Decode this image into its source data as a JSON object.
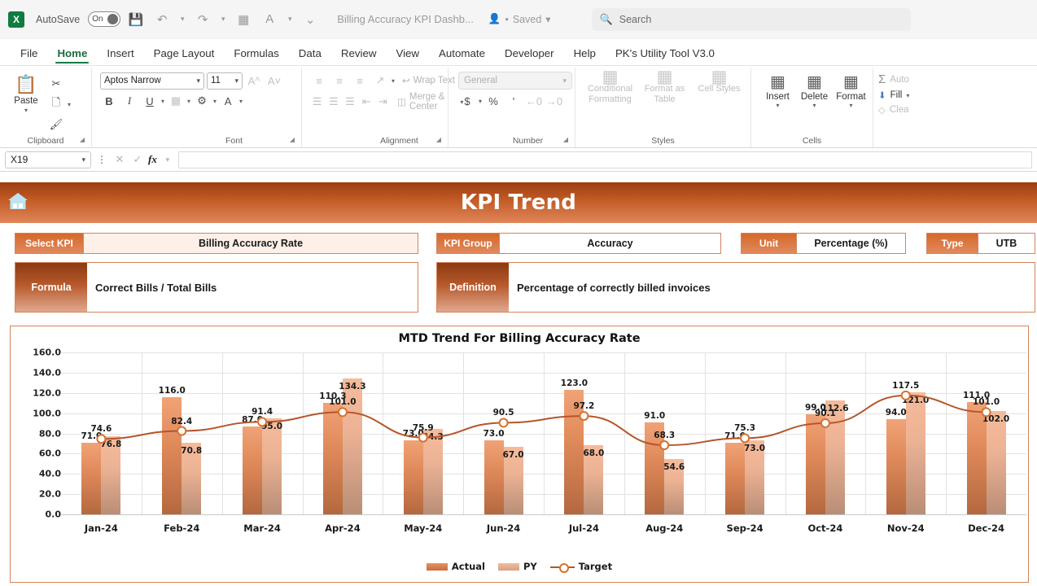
{
  "titlebar": {
    "autosave_label": "AutoSave",
    "autosave_state": "On",
    "document_title": "Billing Accuracy KPI Dashb...",
    "save_status": "Saved",
    "search_placeholder": "Search"
  },
  "menu": {
    "tabs": [
      {
        "label": "File",
        "active": false
      },
      {
        "label": "Home",
        "active": true
      },
      {
        "label": "Insert",
        "active": false
      },
      {
        "label": "Page Layout",
        "active": false
      },
      {
        "label": "Formulas",
        "active": false
      },
      {
        "label": "Data",
        "active": false
      },
      {
        "label": "Review",
        "active": false
      },
      {
        "label": "View",
        "active": false
      },
      {
        "label": "Automate",
        "active": false
      },
      {
        "label": "Developer",
        "active": false
      },
      {
        "label": "Help",
        "active": false
      },
      {
        "label": "PK's Utility Tool V3.0",
        "active": false
      }
    ]
  },
  "ribbon": {
    "clipboard": {
      "group_label": "Clipboard",
      "paste_label": "Paste"
    },
    "font": {
      "group_label": "Font",
      "font_name": "Aptos Narrow",
      "font_size": "11"
    },
    "alignment": {
      "group_label": "Alignment",
      "wrap_text": "Wrap Text",
      "merge_center": "Merge & Center"
    },
    "number": {
      "group_label": "Number",
      "format_value": "General"
    },
    "styles": {
      "group_label": "Styles",
      "conditional_formatting": "Conditional Formatting",
      "format_as_table": "Format as Table",
      "cell_styles": "Cell Styles"
    },
    "cells": {
      "group_label": "Cells",
      "insert": "Insert",
      "delete": "Delete",
      "format": "Format"
    },
    "editing": {
      "autosum": "Auto",
      "fill": "Fill",
      "clear": "Clea"
    }
  },
  "formula_bar": {
    "name_box": "X19",
    "formula_value": ""
  },
  "dashboard": {
    "banner_title": "KPI Trend",
    "chips": [
      {
        "label": "Select KPI",
        "value": "Billing Accuracy Rate"
      },
      {
        "label": "KPI Group",
        "value": "Accuracy"
      },
      {
        "label": "Unit",
        "value": "Percentage (%)"
      },
      {
        "label": "Type",
        "value": "UTB"
      }
    ],
    "info": [
      {
        "label": "Formula",
        "value": "Correct Bills / Total Bills"
      },
      {
        "label": "Definition",
        "value": "Percentage of correctly billed invoices"
      }
    ]
  },
  "chart_data": {
    "type": "bar",
    "title": "MTD Trend For Billing Accuracy Rate",
    "xlabel": "",
    "ylabel": "",
    "ylim": [
      0,
      160
    ],
    "yticks": [
      0,
      20,
      40,
      60,
      80,
      100,
      120,
      140,
      160
    ],
    "ytick_labels": [
      "0.0",
      "20.0",
      "40.0",
      "60.0",
      "80.0",
      "100.0",
      "120.0",
      "140.0",
      "160.0"
    ],
    "grid": true,
    "legend_position": "bottom",
    "categories": [
      "Jan-24",
      "Feb-24",
      "Mar-24",
      "Apr-24",
      "May-24",
      "Jun-24",
      "Jul-24",
      "Aug-24",
      "Sep-24",
      "Oct-24",
      "Nov-24",
      "Dec-24"
    ],
    "series": [
      {
        "name": "Actual",
        "type": "bar",
        "color": "#c4703f",
        "values": [
          71.0,
          116.0,
          87.0,
          110.3,
          73.0,
          73.0,
          123.0,
          91.0,
          71.0,
          99.0,
          94.0,
          111.0
        ],
        "labels": [
          "71.0",
          "116.0",
          "87.0",
          "110.3",
          "73.0",
          "73.0",
          "123.0",
          "91.0",
          "71.0",
          "99.0",
          "94.0",
          "111.0"
        ]
      },
      {
        "name": "PY",
        "type": "bar",
        "color": "#e0ab8d",
        "values": [
          76.8,
          70.8,
          95.0,
          134.3,
          84.3,
          67.0,
          68.0,
          54.6,
          73.0,
          112.6,
          121.0,
          102.0
        ],
        "labels": [
          "76.8",
          "70.8",
          "95.0",
          "134.3",
          "84.3",
          "67.0",
          "68.0",
          "54.6",
          "73.0",
          "112.6",
          "121.0",
          "102.0"
        ]
      },
      {
        "name": "Target",
        "type": "line",
        "color": "#b5562a",
        "marker": "circle",
        "values": [
          74.6,
          82.4,
          91.4,
          101.0,
          75.9,
          90.5,
          97.2,
          68.3,
          75.3,
          90.1,
          117.5,
          101.0
        ],
        "labels": [
          "74.6",
          "82.4",
          "91.4",
          "101.0",
          "75.9",
          "90.5",
          "97.2",
          "68.3",
          "75.3",
          "90.1",
          "117.5",
          "101.0"
        ]
      }
    ]
  },
  "colors": {
    "accent": "#c4703f",
    "banner_dark": "#9c3d12",
    "banner_light": "#e0865a",
    "chip_border": "#d4845b",
    "chip_fill": "#fdf0e9",
    "excel_green": "#107c41"
  }
}
